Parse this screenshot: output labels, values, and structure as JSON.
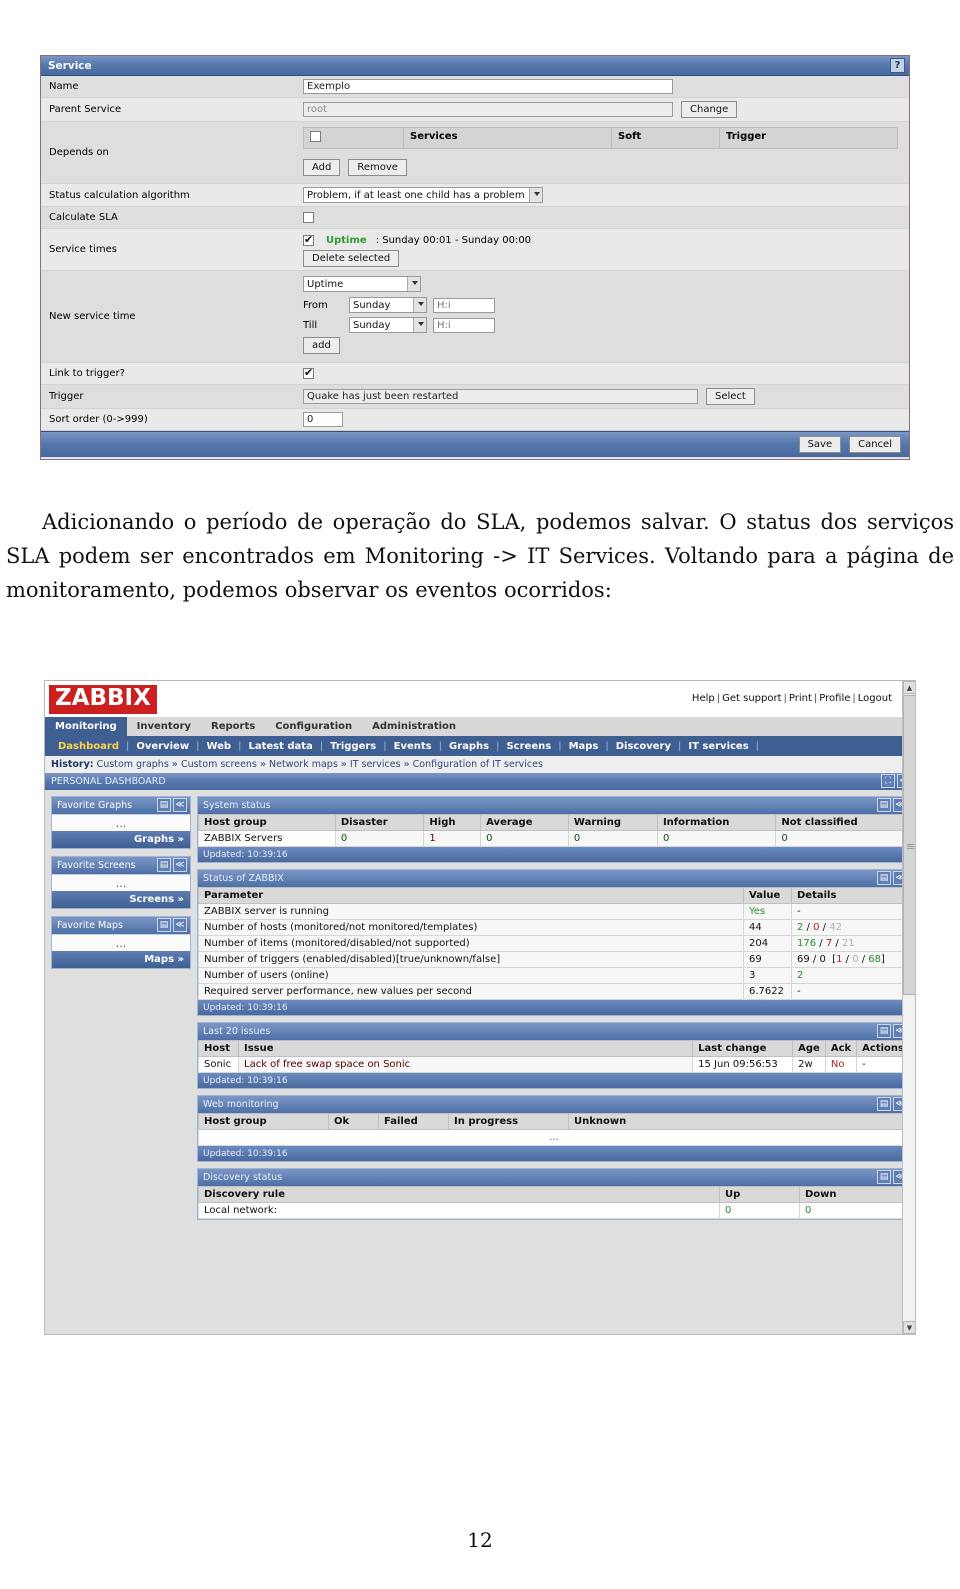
{
  "service_form": {
    "title": "Service",
    "help_icon": "?",
    "rows": {
      "name_label": "Name",
      "name_value": "Exemplo",
      "parent_label": "Parent Service",
      "parent_value": "root",
      "change_button": "Change",
      "depends_label": "Depends on",
      "depends_columns": [
        "",
        "Services",
        "Soft",
        "Trigger"
      ],
      "add_button": "Add",
      "remove_button": "Remove",
      "status_algo_label": "Status calculation algorithm",
      "status_algo_value": "Problem, if at least one child has a problem",
      "calculate_sla_label": "Calculate SLA",
      "calculate_sla_checked": false,
      "service_times_label": "Service times",
      "service_time_entry_checked": true,
      "service_time_entry_type": "Uptime",
      "service_time_entry_range": ": Sunday 00:01 - Sunday 00:00",
      "delete_selected_button": "Delete selected",
      "new_service_time_label": "New service time",
      "new_time_type": "Uptime",
      "from_label": "From",
      "from_day": "Sunday",
      "from_time_placeholder": "H:i",
      "till_label": "Till",
      "till_day": "Sunday",
      "till_time_placeholder": "H:i",
      "add_small_button": "add",
      "link_trigger_label": "Link to trigger?",
      "link_trigger_checked": true,
      "trigger_label": "Trigger",
      "trigger_value": "Quake has just been restarted",
      "select_button": "Select",
      "sort_order_label": "Sort order (0->999)",
      "sort_order_value": "0"
    },
    "footer": {
      "save_button": "Save",
      "cancel_button": "Cancel"
    }
  },
  "paragraph": {
    "line1": "Adicionando o período de operação do SLA, podemos salvar. O status dos serviços SLA podem ser encontrados em Monitoring -> IT Services. Voltando para a página de monitoramento, podemos observar os eventos ocorridos:"
  },
  "zabbix": {
    "logo": "ZABBIX",
    "toplinks": [
      "Help",
      "Get support",
      "Print",
      "Profile",
      "Logout"
    ],
    "menu": [
      {
        "label": "Monitoring",
        "active": true
      },
      {
        "label": "Inventory",
        "active": false
      },
      {
        "label": "Reports",
        "active": false
      },
      {
        "label": "Configuration",
        "active": false
      },
      {
        "label": "Administration",
        "active": false
      }
    ],
    "submenu": [
      {
        "label": "Dashboard",
        "active": true
      },
      {
        "label": "Overview",
        "active": false
      },
      {
        "label": "Web",
        "active": false
      },
      {
        "label": "Latest data",
        "active": false
      },
      {
        "label": "Triggers",
        "active": false
      },
      {
        "label": "Events",
        "active": false
      },
      {
        "label": "Graphs",
        "active": false
      },
      {
        "label": "Screens",
        "active": false
      },
      {
        "label": "Maps",
        "active": false
      },
      {
        "label": "Discovery",
        "active": false
      },
      {
        "label": "IT services",
        "active": false
      }
    ],
    "history": {
      "label": "History:",
      "items": [
        "Custom graphs",
        "Custom screens",
        "Network maps",
        "IT services",
        "Configuration of IT services"
      ]
    },
    "page_title": "PERSONAL DASHBOARD",
    "favorites": [
      {
        "title": "Favorite Graphs",
        "body": "...",
        "footer": "Graphs »"
      },
      {
        "title": "Favorite Screens",
        "body": "...",
        "footer": "Screens »"
      },
      {
        "title": "Favorite Maps",
        "body": "...",
        "footer": "Maps »"
      }
    ],
    "system_status": {
      "title": "System status",
      "columns": [
        "Host group",
        "Disaster",
        "High",
        "Average",
        "Warning",
        "Information",
        "Not classified"
      ],
      "rows": [
        {
          "host_group": "ZABBIX Servers",
          "disaster": "0",
          "high": "1",
          "average": "0",
          "warning": "0",
          "information": "0",
          "not_classified": "0"
        }
      ],
      "updated": "Updated: 10:39:16"
    },
    "status_of_zabbix": {
      "title": "Status of ZABBIX",
      "columns": [
        "Parameter",
        "Value",
        "Details"
      ],
      "rows": [
        {
          "parameter": "ZABBIX server is running",
          "value": "Yes",
          "details": "-"
        },
        {
          "parameter": "Number of hosts (monitored/not monitored/templates)",
          "value": "44",
          "details": "2 / 0 / 42"
        },
        {
          "parameter": "Number of items (monitored/disabled/not supported)",
          "value": "204",
          "details": "176 / 7 / 21"
        },
        {
          "parameter": "Number of triggers (enabled/disabled)[true/unknown/false]",
          "value": "69",
          "details": "69 / 0  [1 / 0 / 68]"
        },
        {
          "parameter": "Number of users (online)",
          "value": "3",
          "details": "2"
        },
        {
          "parameter": "Required server performance, new values per second",
          "value": "6.7622",
          "details": "-"
        }
      ],
      "updated": "Updated: 10:39:16"
    },
    "last_issues": {
      "title": "Last 20 issues",
      "columns": [
        "Host",
        "Issue",
        "Last change",
        "Age",
        "Ack",
        "Actions"
      ],
      "rows": [
        {
          "host": "Sonic",
          "issue": "Lack of free swap space on Sonic",
          "last_change": "15 Jun 09:56:53",
          "age": "2w",
          "ack": "No",
          "actions": "-"
        }
      ],
      "updated": "Updated: 10:39:16"
    },
    "web_monitoring": {
      "title": "Web monitoring",
      "columns": [
        "Host group",
        "Ok",
        "Failed",
        "In progress",
        "Unknown"
      ],
      "empty_row": "...",
      "updated": "Updated: 10:39:16"
    },
    "discovery_status": {
      "title": "Discovery status",
      "columns": [
        "Discovery rule",
        "Up",
        "Down"
      ],
      "rows": [
        {
          "rule": "Local network:",
          "up": "0",
          "down": "0"
        }
      ]
    },
    "widget_icons": {
      "menu": "▤",
      "collapse": "≪"
    }
  },
  "page_number": "12"
}
